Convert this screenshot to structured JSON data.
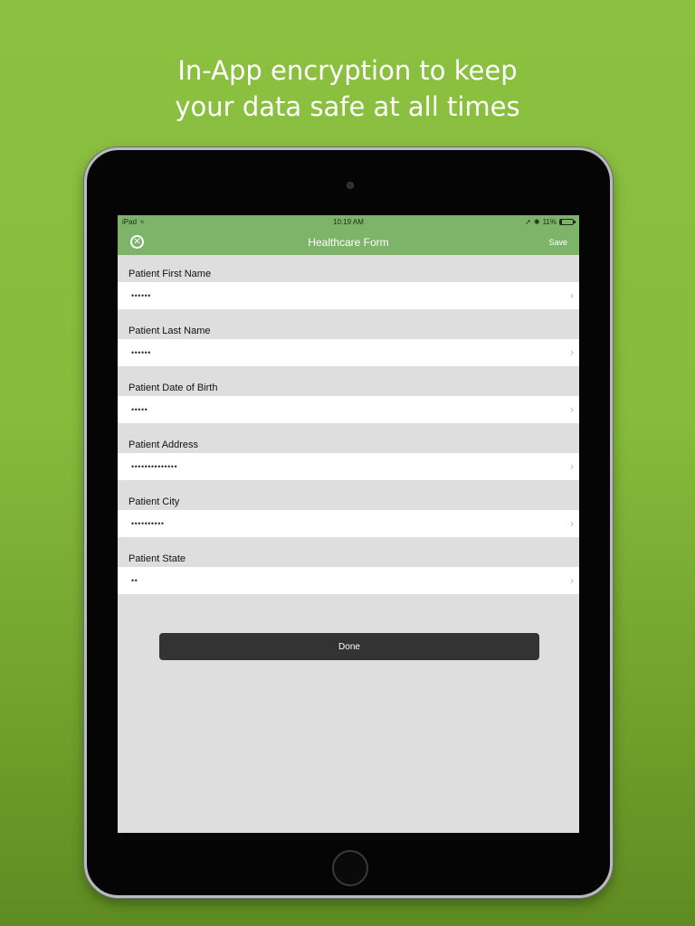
{
  "promo": {
    "line1": "In-App encryption to keep",
    "line2": "your data safe at all times"
  },
  "status_bar": {
    "device": "iPad",
    "time": "10:19 AM",
    "battery": "11%"
  },
  "nav": {
    "title": "Healthcare Form",
    "save_label": "Save"
  },
  "fields": [
    {
      "label": "Patient First Name",
      "value": "••••••"
    },
    {
      "label": "Patient Last Name",
      "value": "••••••"
    },
    {
      "label": "Patient Date of Birth",
      "value": "•••••"
    },
    {
      "label": "Patient Address",
      "value": "••••••••••••••"
    },
    {
      "label": "Patient City",
      "value": "••••••••••"
    },
    {
      "label": "Patient State",
      "value": "••"
    }
  ],
  "done_label": "Done",
  "colors": {
    "background": "#86bb3c",
    "nav": "#7db46a",
    "button": "#333333"
  }
}
